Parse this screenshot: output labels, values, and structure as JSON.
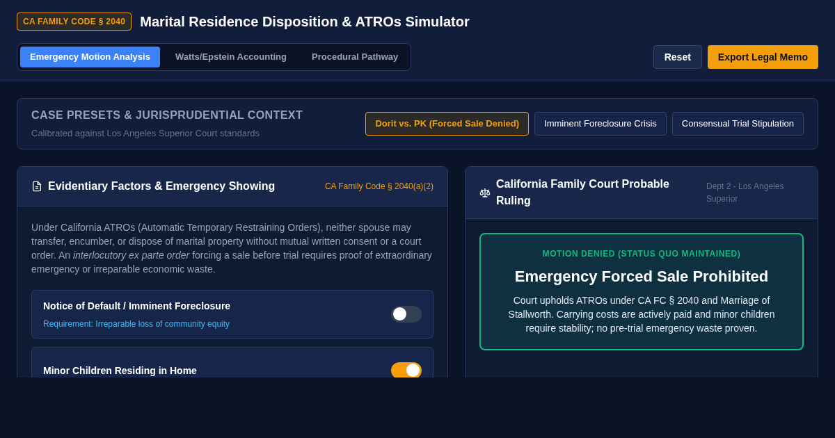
{
  "header": {
    "badge": "CA FAMILY CODE § 2040",
    "title": "Marital Residence Disposition & ATROs Simulator"
  },
  "tabs": [
    {
      "label": "Emergency Motion Analysis",
      "selected": true
    },
    {
      "label": "Watts/Epstein Accounting",
      "selected": false
    },
    {
      "label": "Procedural Pathway",
      "selected": false
    }
  ],
  "actions": {
    "reset": "Reset",
    "export": "Export Legal Memo"
  },
  "presets": {
    "title": "CASE PRESETS & JURISPRUDENTIAL CONTEXT",
    "subtitle": "Calibrated against Los Angeles Superior Court standards",
    "items": [
      {
        "label": "Dorit vs. PK (Forced Sale Denied)",
        "selected": true
      },
      {
        "label": "Imminent Foreclosure Crisis",
        "selected": false
      },
      {
        "label": "Consensual Trial Stipulation",
        "selected": false
      }
    ]
  },
  "factors": {
    "title": "Evidentiary Factors & Emergency Showing",
    "code": "CA Family Code § 2040(a)(2)",
    "intro": "Under California ATROs (Automatic Temporary Restraining Orders), neither spouse may transfer, encumber, or dispose of marital property without mutual written consent or a court order. An *interlocutory ex parte order* forcing a sale before trial requires proof of extraordinary emergency or irreparable economic waste.",
    "items": [
      {
        "label": "Notice of Default / Imminent Foreclosure",
        "note": "Requirement: Irreparable loss of community equity",
        "on": false
      },
      {
        "label": "Minor Children Residing in Home",
        "on": true
      }
    ]
  },
  "ruling": {
    "title": "California Family Court Probable Ruling",
    "dept": "Dept 2 - Los Angeles Superior",
    "status": "MOTION DENIED (STATUS QUO MAINTAINED)",
    "headline": "Emergency Forced Sale Prohibited",
    "body": "Court upholds ATROs under CA FC § 2040 and Marriage of Stallworth. Carrying costs are actively paid and minor children require stability; no pre-trial emergency waste proven."
  }
}
